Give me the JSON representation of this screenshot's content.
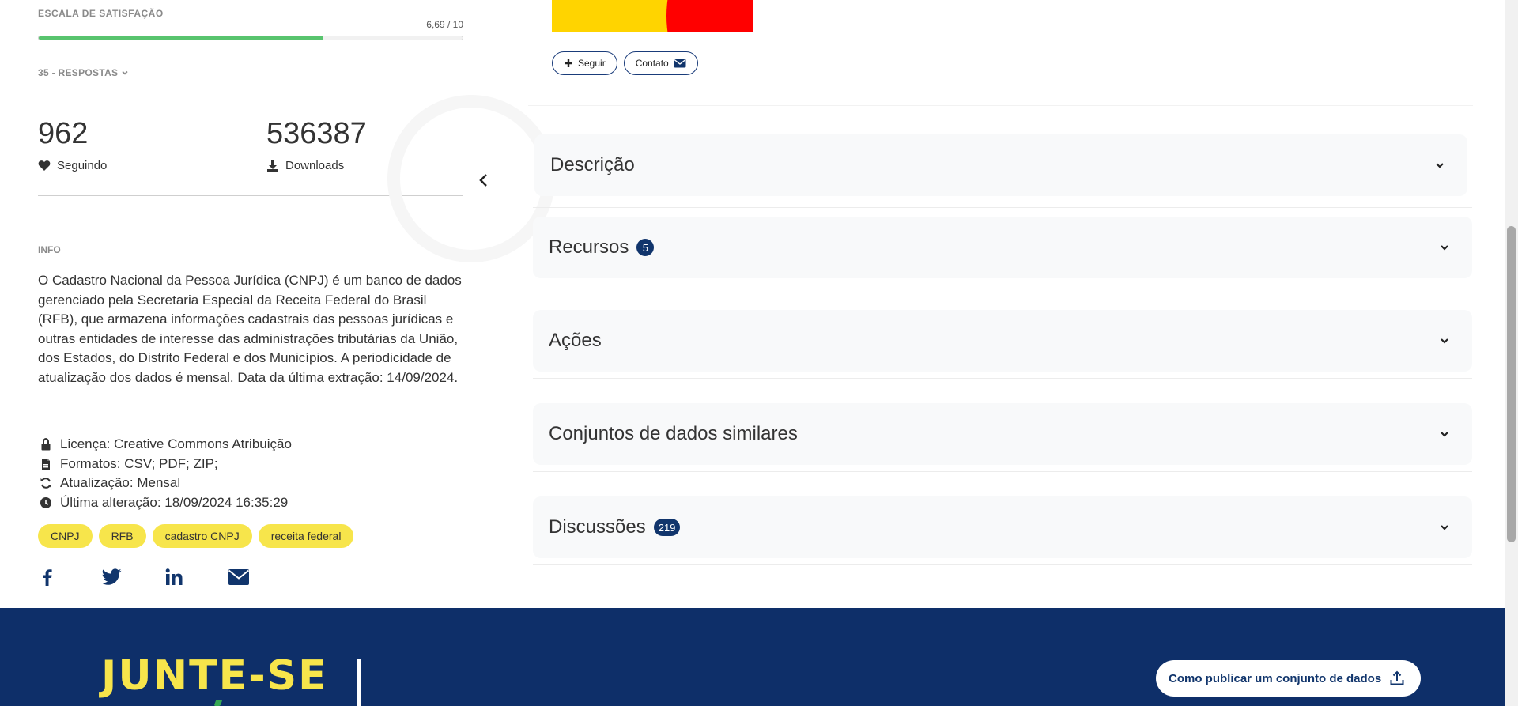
{
  "satisfaction": {
    "label": "ESCALA DE SATISFAÇÃO",
    "score_text": "6,69 / 10",
    "fill_fraction": 0.669,
    "fill_color": "#58c46e"
  },
  "responses": {
    "label": "35 - RESPOSTAS"
  },
  "stats": {
    "following": {
      "value": "962",
      "label": "Seguindo",
      "icon": "heart-icon"
    },
    "downloads": {
      "value": "536387",
      "label": "Downloads",
      "icon": "download-icon"
    }
  },
  "info": {
    "label": "INFO",
    "description": "O Cadastro Nacional da Pessoa Jurídica (CNPJ) é um banco de dados gerenciado pela Secretaria Especial da Receita Federal do Brasil (RFB), que armazena informações cadastrais das pessoas jurídicas e outras entidades de interesse das administrações tributárias da União, dos Estados, do Distrito Federal e dos Municípios. A periodicidade de atualização dos dados é mensal. Data da última extração: 14/09/2024."
  },
  "meta": {
    "license": "Licença: Creative Commons Atribuição",
    "formats": "Formatos: CSV; PDF; ZIP;",
    "update": "Atualização: Mensal",
    "last_change": "Última alteração: 18/09/2024 16:35:29"
  },
  "tags": [
    "CNPJ",
    "RFB",
    "cadastro CNPJ",
    "receita federal"
  ],
  "social": [
    "facebook-icon",
    "twitter-icon",
    "linkedin-icon",
    "mail-icon"
  ],
  "actions": {
    "follow": "Seguir",
    "contact": "Contato"
  },
  "accordion": {
    "descricao": {
      "title": "Descrição"
    },
    "recursos": {
      "title": "Recursos",
      "badge": "5"
    },
    "acoes": {
      "title": "Ações"
    },
    "similares": {
      "title": "Conjuntos de dados similares"
    },
    "discussoes": {
      "title": "Discussões",
      "badge": "219"
    }
  },
  "footer": {
    "join": "JUNTE-SE",
    "publish": "Como publicar um conjunto de dados"
  },
  "colors": {
    "brand_blue": "#0e2f69",
    "badge_blue": "#11356c",
    "tag_yellow": "#f7e54b",
    "card_bg": "#f8f9fa"
  }
}
